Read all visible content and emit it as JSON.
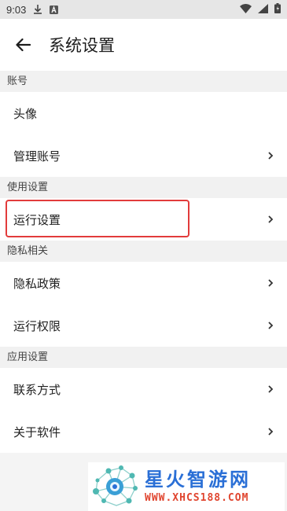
{
  "status_bar": {
    "time": "9:03",
    "icons": [
      "download-icon",
      "a-badge-icon",
      "wifi-icon",
      "signal-icon",
      "battery-icon"
    ]
  },
  "header": {
    "title": "系统设置"
  },
  "sections": [
    {
      "label": "账号",
      "items": [
        {
          "label": "头像",
          "chevron": false
        },
        {
          "label": "管理账号",
          "chevron": true
        }
      ]
    },
    {
      "label": "使用设置",
      "items": [
        {
          "label": "运行设置",
          "chevron": true,
          "highlighted": true
        }
      ]
    },
    {
      "label": "隐私相关",
      "items": [
        {
          "label": "隐私政策",
          "chevron": true
        },
        {
          "label": "运行权限",
          "chevron": true
        }
      ]
    },
    {
      "label": "应用设置",
      "items": [
        {
          "label": "联系方式",
          "chevron": true
        },
        {
          "label": "关于软件",
          "chevron": true
        }
      ]
    }
  ],
  "watermark": {
    "title": "星火智游网",
    "url": "WWW.XHCS188.COM"
  },
  "colors": {
    "highlight": "#e23b3b",
    "watermark_blue": "#2a6fd6",
    "watermark_red": "#e0452f"
  }
}
